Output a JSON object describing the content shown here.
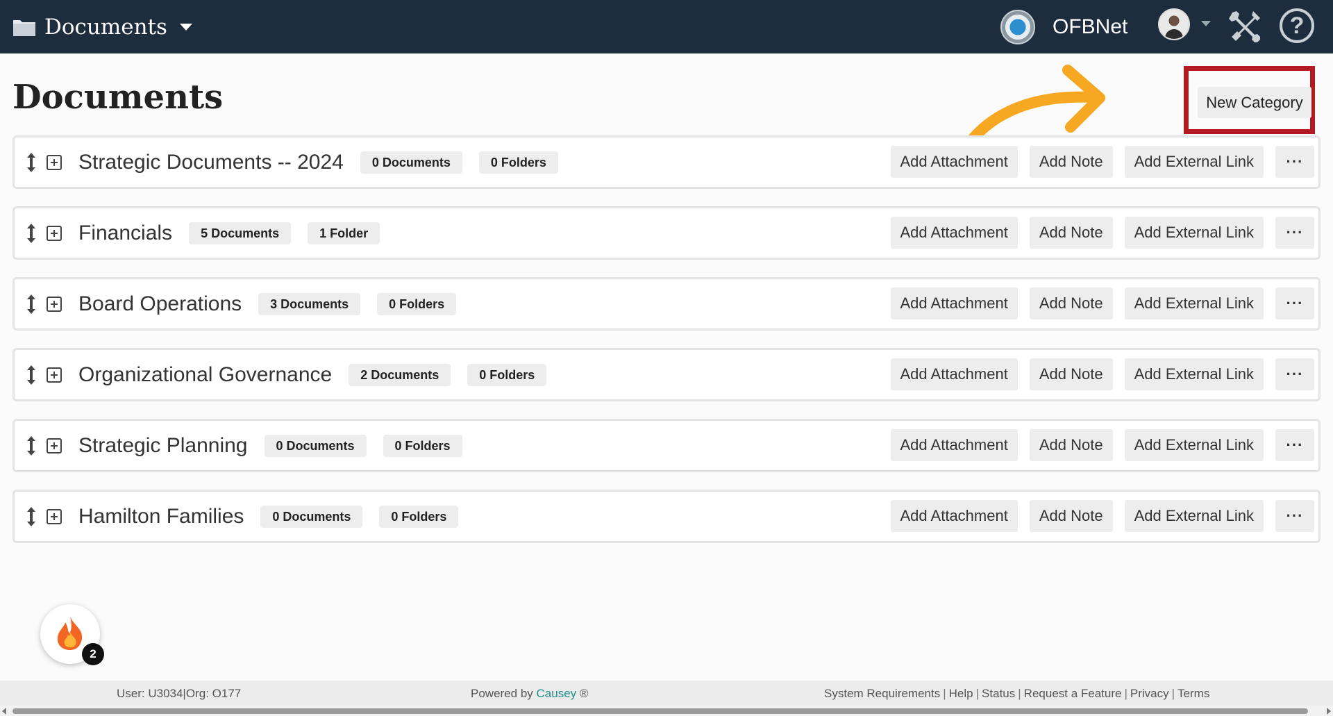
{
  "navbar": {
    "section_title": "Documents",
    "org_name": "OFBNet",
    "icons": {
      "section": "folder-icon",
      "org": "org-logo-icon",
      "profile": "avatar",
      "tools": "tools-icon",
      "help": "help-icon"
    }
  },
  "page": {
    "title": "Documents",
    "new_category_label": "New Category"
  },
  "row_actions": {
    "add_attachment": "Add Attachment",
    "add_note": "Add Note",
    "add_external_link": "Add External Link",
    "more": "···"
  },
  "categories": [
    {
      "name": "Strategic Documents -- 2024",
      "documents": "0 Documents",
      "folders": "0 Folders"
    },
    {
      "name": "Financials",
      "documents": "5 Documents",
      "folders": "1 Folder"
    },
    {
      "name": "Board Operations",
      "documents": "3 Documents",
      "folders": "0 Folders"
    },
    {
      "name": "Organizational Governance",
      "documents": "2 Documents",
      "folders": "0 Folders"
    },
    {
      "name": "Strategic Planning",
      "documents": "0 Documents",
      "folders": "0 Folders"
    },
    {
      "name": "Hamilton Families",
      "documents": "0 Documents",
      "folders": "0 Folders"
    }
  ],
  "widget": {
    "count": "2"
  },
  "footer": {
    "user": "User: U3034|Org: O177",
    "powered_by": "Powered by",
    "brand": "Causey",
    "registered": "®",
    "links": [
      "System Requirements",
      "Help",
      "Status",
      "Request a Feature",
      "Privacy",
      "Terms"
    ]
  },
  "colors": {
    "navbar_bg": "#1d2d3d",
    "highlight": "#b31b22",
    "arrow": "#f7a823",
    "brand_link": "#1d8f8a"
  }
}
